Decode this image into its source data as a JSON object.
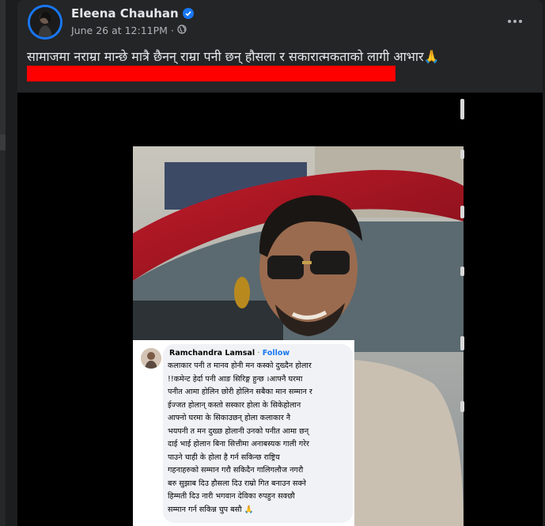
{
  "post": {
    "author": "Eleena Chauhan",
    "date": "June 26 at 12:11PM",
    "separator": "·",
    "caption": "सामाजमा नराम्रा मान्छे मात्रै छैनन् राम्रा पनी छन् हौसला र सकारात्मकताको लागी आभार🙏"
  },
  "icons": {
    "verified": "verified-badge-icon",
    "privacy": "public-globe-icon",
    "more": "more-options-icon"
  },
  "comment": {
    "name": "Ramchandra Lamsal",
    "dot": "·",
    "follow": "Follow",
    "lines": [
      "कलाकार पनी त मानव होनी मन कस्को दुख्दैन होलार",
      "!!कमेन्ट हेर्दा पनी आङ सिरिङ्ग हुन्छ ।आफ्नै घरमा",
      "पनीत आमा होलिन छोरी होलिन सबैका मान सम्मान र",
      "ईज्जत होलान् कस्तो सस्कार होला के सिकेहोलान",
      "आफ्नो घरमा के सिकाउछन् होला कलाकार नै",
      "भयपनी त मन दुख्छ होलानी उनको पनीत आमा छन्",
      "दाई भाई होलान बिना सित्तीमा अनाबस्यक गाली गरेर",
      "पाउने चाही के होला है गर्न सकिन्छ राष्ट्रिय",
      "गहनाहरुको सम्मान गरौ सकिदैन गालिगलौज नगरौ",
      "बरु सुझाब दिउ हौसला दिउ राम्रो गित बनाउन सक्ने",
      "हिम्मती दिउ नारी भगवान देविका रुपहुन सक्छौ",
      "सम्मान गर्न सकिन्न चुप बसौ 🙏"
    ]
  },
  "colors": {
    "page_bg": "#1c1d1e",
    "card_bg": "#242526",
    "accent": "#1877f2",
    "redaction": "#ff0000",
    "text_primary": "#e4e6eb",
    "text_secondary": "#b0b3b8"
  }
}
